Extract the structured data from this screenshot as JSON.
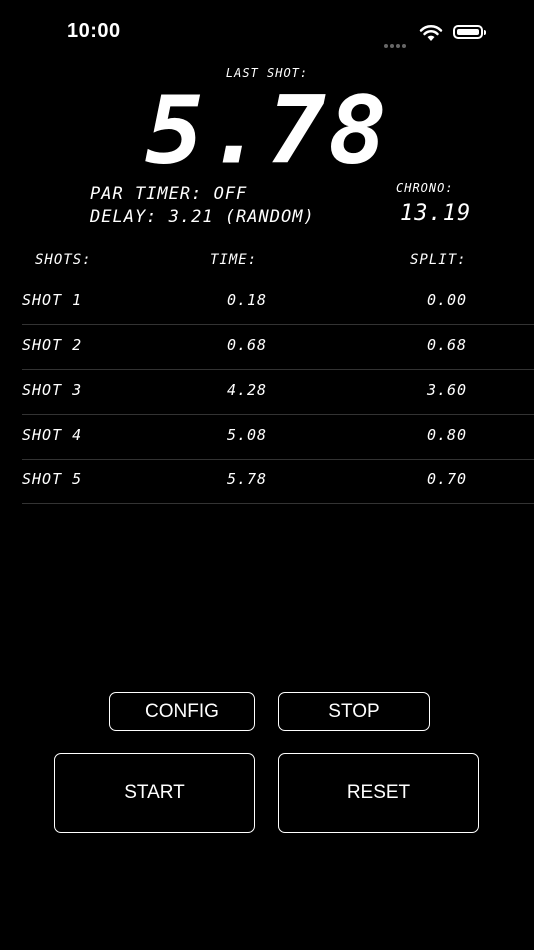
{
  "status_bar": {
    "time": "10:00"
  },
  "display": {
    "last_shot_label": "LAST SHOT:",
    "last_shot_value": "5.78",
    "par_timer": "PAR TIMER: OFF",
    "delay": "DELAY: 3.21 (RANDOM)",
    "chrono_label": "CHRONO:",
    "chrono_value": "13.19"
  },
  "table": {
    "headers": {
      "shots": "SHOTS:",
      "time": "TIME:",
      "split": "SPLIT:"
    },
    "rows": [
      {
        "shot": "SHOT 1",
        "time": "0.18",
        "split": "0.00"
      },
      {
        "shot": "SHOT 2",
        "time": "0.68",
        "split": "0.68"
      },
      {
        "shot": "SHOT 3",
        "time": "4.28",
        "split": "3.60"
      },
      {
        "shot": "SHOT 4",
        "time": "5.08",
        "split": "0.80"
      },
      {
        "shot": "SHOT 5",
        "time": "5.78",
        "split": "0.70"
      }
    ]
  },
  "buttons": {
    "config": "CONFIG",
    "stop": "STOP",
    "start": "START",
    "reset": "RESET"
  },
  "icons": {
    "signal": "signal-dots-icon",
    "wifi": "wifi-icon",
    "battery": "battery-icon"
  }
}
